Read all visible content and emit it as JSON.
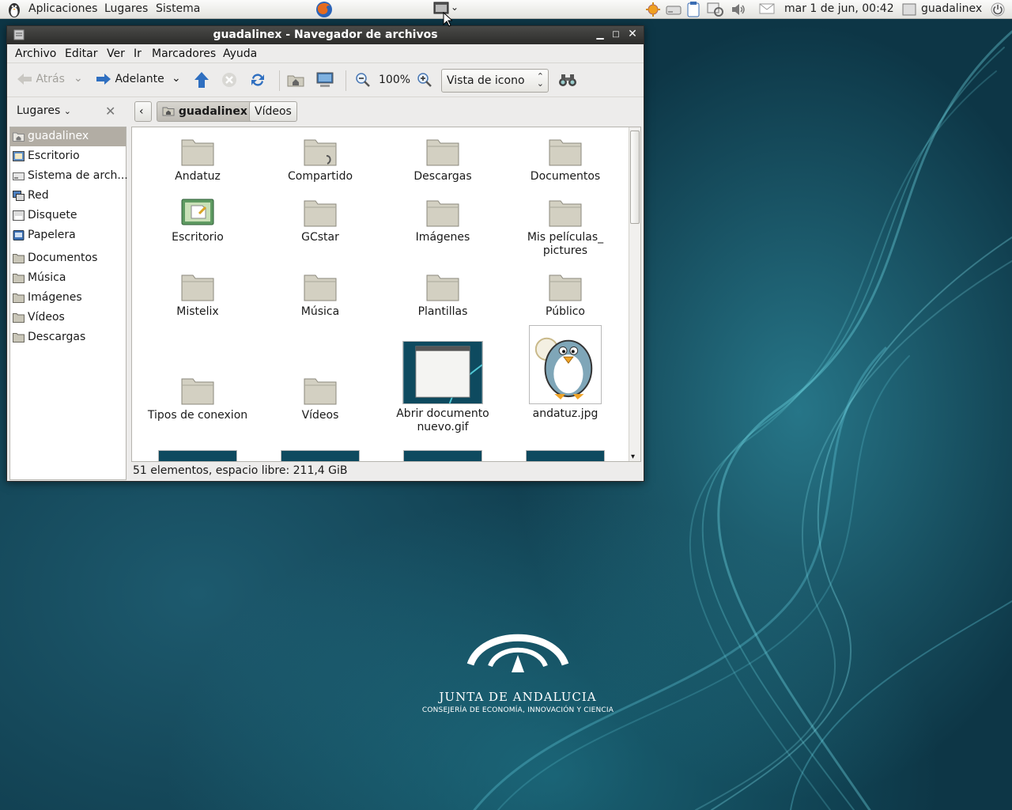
{
  "panel": {
    "menus": [
      "Aplicaciones",
      "Lugares",
      "Sistema"
    ],
    "clock": "mar  1 de jun, 00:42",
    "user": "guadalinex"
  },
  "window": {
    "title": "guadalinex - Navegador de archivos",
    "menus": [
      "Archivo",
      "Editar",
      "Ver",
      "Ir",
      "Marcadores",
      "Ayuda"
    ],
    "toolbar": {
      "back_label": "Atrás",
      "forward_label": "Adelante",
      "zoom_level": "100%",
      "view_mode": "Vista de icono"
    },
    "sidebar_title": "Lugares",
    "breadcrumbs": [
      "guadalinex",
      "Vídeos"
    ],
    "places": [
      {
        "label": "guadalinex",
        "icon": "home-icon"
      },
      {
        "label": "Escritorio",
        "icon": "desktop-icon"
      },
      {
        "label": "Sistema de arch...",
        "icon": "drive-icon"
      },
      {
        "label": "Red",
        "icon": "network-icon"
      },
      {
        "label": "Disquete",
        "icon": "floppy-icon"
      },
      {
        "label": "Papelera",
        "icon": "trash-icon"
      }
    ],
    "bookmarks": [
      "Documentos",
      "Música",
      "Imágenes",
      "Vídeos",
      "Descargas"
    ],
    "files": [
      {
        "name": "Andatuz",
        "kind": "folder"
      },
      {
        "name": "Compartido",
        "kind": "folder-shared"
      },
      {
        "name": "Descargas",
        "kind": "folder"
      },
      {
        "name": "Documentos",
        "kind": "folder"
      },
      {
        "name": "Escritorio",
        "kind": "desktop"
      },
      {
        "name": "GCstar",
        "kind": "folder"
      },
      {
        "name": "Imágenes",
        "kind": "folder"
      },
      {
        "name": "Mis películas_ pictures",
        "kind": "folder"
      },
      {
        "name": "Mistelix",
        "kind": "folder"
      },
      {
        "name": "Música",
        "kind": "folder"
      },
      {
        "name": "Plantillas",
        "kind": "folder"
      },
      {
        "name": "Público",
        "kind": "folder"
      },
      {
        "name": "Tipos de conexion",
        "kind": "folder"
      },
      {
        "name": "Vídeos",
        "kind": "folder"
      },
      {
        "name": "Abrir documento nuevo.gif",
        "kind": "image"
      },
      {
        "name": "andatuz.jpg",
        "kind": "image-penguin"
      }
    ],
    "status": "51 elementos, espacio libre: 211,4 GiB"
  },
  "wallpaper": {
    "logo_title": "JUNTA DE ANDALUCIA",
    "logo_subtitle": "CONSEJERÍA DE ECONOMÍA, INNOVACIÓN Y CIENCIA"
  }
}
